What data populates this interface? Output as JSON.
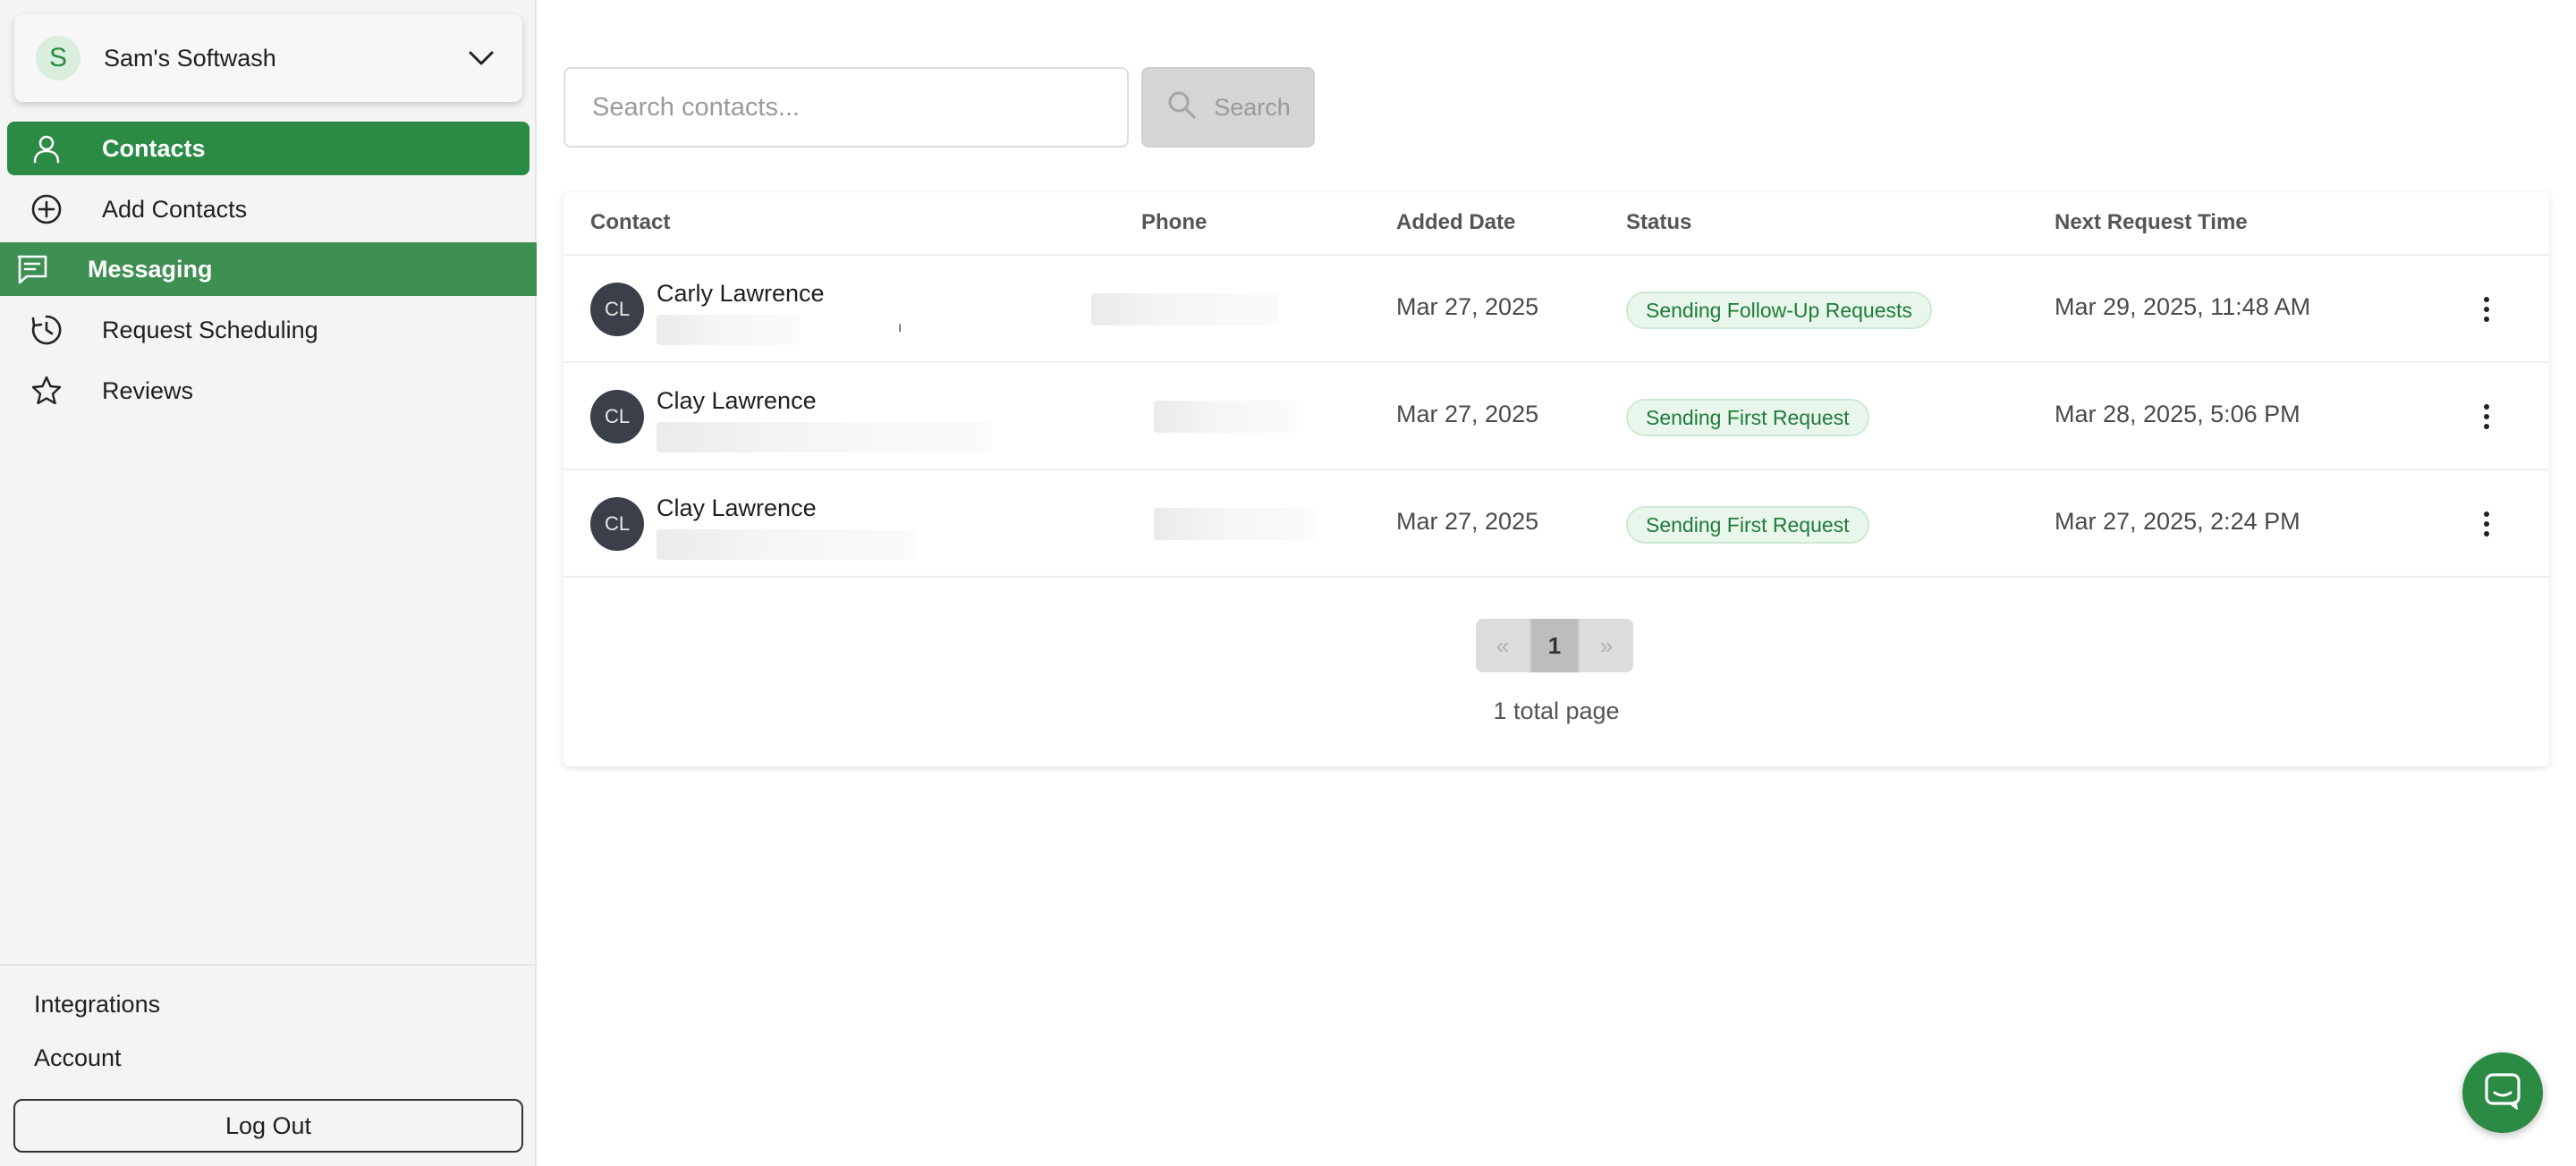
{
  "business": {
    "name": "Sam's Softwash",
    "initial": "S"
  },
  "nav": [
    {
      "label": "Contacts",
      "icon": "user-icon"
    },
    {
      "label": "Add Contacts",
      "icon": "plus-circle-icon"
    },
    {
      "label": "Messaging",
      "icon": "message-icon"
    },
    {
      "label": "Request Scheduling",
      "icon": "clock-icon"
    },
    {
      "label": "Reviews",
      "icon": "star-icon"
    }
  ],
  "footer": {
    "integrations": "Integrations",
    "account": "Account",
    "logout": "Log Out"
  },
  "search": {
    "placeholder": "Search contacts...",
    "button_label": "Search"
  },
  "table": {
    "headers": {
      "contact": "Contact",
      "phone": "Phone",
      "added": "Added Date",
      "status": "Status",
      "next": "Next Request Time"
    },
    "rows": [
      {
        "initials": "CL",
        "name": "Carly Lawrence",
        "added": "Mar 27, 2025",
        "status": "Sending Follow-Up Requests",
        "next": "Mar 29, 2025, 11:48 AM",
        "mark": "ı"
      },
      {
        "initials": "CL",
        "name": "Clay Lawrence",
        "added": "Mar 27, 2025",
        "status": "Sending First Request",
        "next": "Mar 28, 2025, 5:06 PM"
      },
      {
        "initials": "CL",
        "name": "Clay Lawrence",
        "added": "Mar 27, 2025",
        "status": "Sending First Request",
        "next": "Mar 27, 2025, 2:24 PM"
      }
    ]
  },
  "pagination": {
    "prev": "«",
    "current": "1",
    "next": "»",
    "total_label": "1 total page"
  },
  "colors": {
    "accent": "#2b8a44",
    "badge_bg": "#e9f6ec",
    "badge_text": "#1f7a38"
  }
}
